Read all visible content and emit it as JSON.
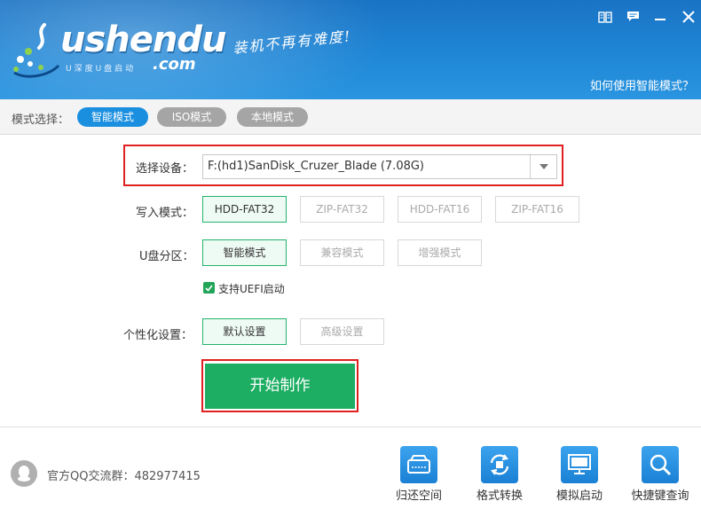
{
  "header": {
    "logo_text": "ushendu",
    "logo_com": ".com",
    "logo_sub": "U深度U盘启动",
    "slogan": "装机不再有难度!",
    "help_link": "如何使用智能模式？",
    "icons": [
      "book-icon",
      "chat-icon",
      "minimize-icon",
      "close-icon"
    ]
  },
  "mode_bar": {
    "label": "模式选择：",
    "tabs": [
      {
        "label": "智能模式",
        "active": true
      },
      {
        "label": "ISO模式",
        "active": false
      },
      {
        "label": "本地模式",
        "active": false
      }
    ]
  },
  "form": {
    "device_label": "选择设备：",
    "device_value": "F:(hd1)SanDisk_Cruzer_Blade (7.08G)",
    "write_label": "写入模式：",
    "write_options": [
      "HDD-FAT32",
      "ZIP-FAT32",
      "HDD-FAT16",
      "ZIP-FAT16"
    ],
    "write_selected": "HDD-FAT32",
    "partition_label": "U盘分区：",
    "partition_options": [
      "智能模式",
      "兼容模式",
      "增强模式"
    ],
    "partition_selected": "智能模式",
    "uefi_label": "支持UEFI启动",
    "uefi_checked": true,
    "personal_label": "个性化设置：",
    "personal_options": [
      "默认设置",
      "高级设置"
    ],
    "personal_selected": "默认设置",
    "start_label": "开始制作"
  },
  "footer": {
    "qq_text": "官方QQ交流群：482977415",
    "tools": [
      {
        "label": "归还空间",
        "icon": "drive-icon"
      },
      {
        "label": "格式转换",
        "icon": "convert-icon"
      },
      {
        "label": "模拟启动",
        "icon": "monitor-icon"
      },
      {
        "label": "快捷键查询",
        "icon": "search-icon"
      }
    ]
  },
  "colors": {
    "header_blue": "#1f86d6",
    "active_tab": "#1a8fe0",
    "start_green": "#1dae63",
    "highlight_red": "#e02020"
  }
}
